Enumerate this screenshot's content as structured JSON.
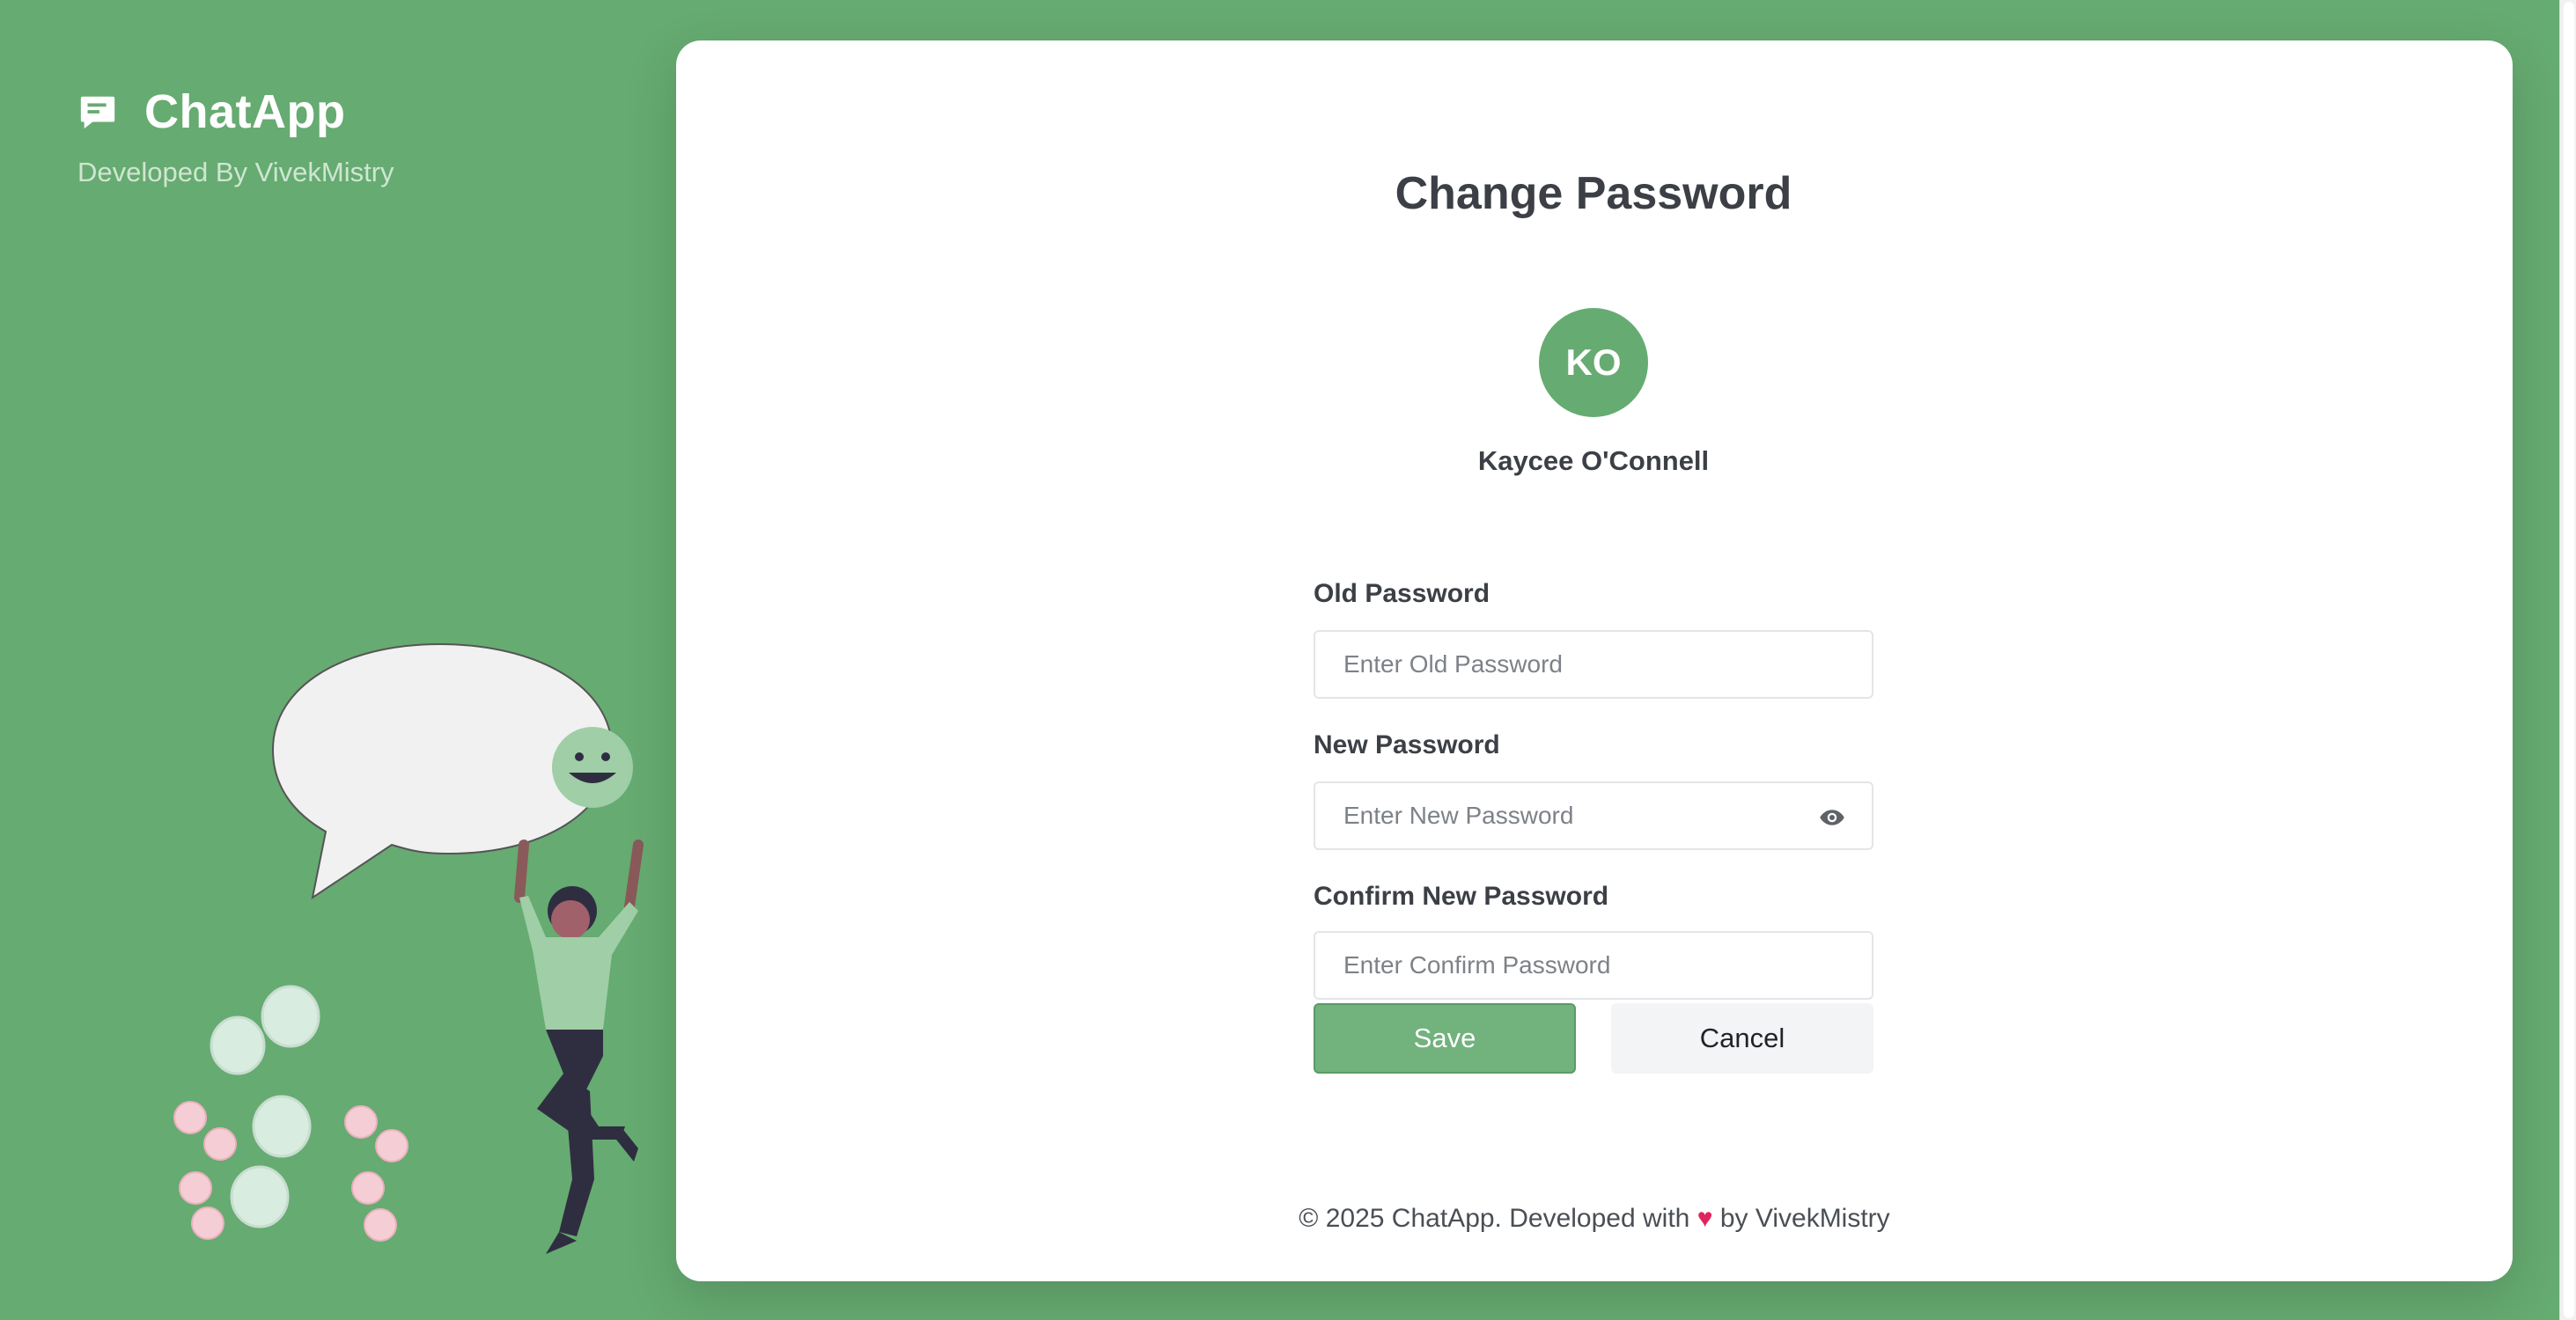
{
  "brand": {
    "title": "ChatApp",
    "subtitle": "Developed By VivekMistry"
  },
  "page": {
    "title": "Change Password"
  },
  "user": {
    "initials": "KO",
    "name": "Kaycee O'Connell"
  },
  "form": {
    "old_password": {
      "label": "Old Password",
      "placeholder": "Enter Old Password",
      "value": ""
    },
    "new_password": {
      "label": "New Password",
      "placeholder": "Enter New Password",
      "value": "",
      "toggle_icon": "eye-icon"
    },
    "confirm_password": {
      "label": "Confirm New Password",
      "placeholder": "Enter Confirm Password",
      "value": ""
    },
    "save_label": "Save",
    "cancel_label": "Cancel"
  },
  "footer": {
    "prefix": "© 2025 ChatApp. Developed with",
    "heart": "♥",
    "suffix": "by VivekMistry"
  },
  "colors": {
    "background": "#66ab71",
    "accent": "#66ab71",
    "heart": "#e0245e"
  },
  "icons": {
    "brand": "chat-bubble-icon",
    "password_toggle": "eye-icon"
  }
}
